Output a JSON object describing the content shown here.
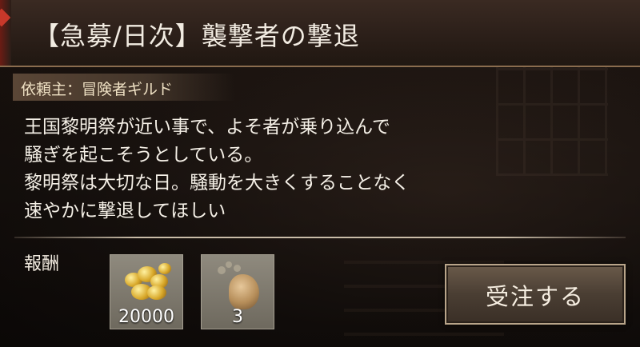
{
  "quest": {
    "title": "【急募/日次】襲撃者の撃退",
    "client": "依頼主：冒険者ギルド",
    "description": [
      "王国黎明祭が近い事で、よそ者が乗り込んで",
      "騒ぎを起こそうとしている。",
      "黎明祭は大切な日。騒動を大きくすることなく",
      "速やかに撃退してほしい"
    ]
  },
  "rewards": {
    "label": "報酬",
    "items": [
      {
        "icon": "gold-coins-icon",
        "count": "20000"
      },
      {
        "icon": "ore-stone-icon",
        "count": "3"
      }
    ]
  },
  "accept_button": {
    "label": "受注する"
  },
  "colors": {
    "accent_red": "#c8382a",
    "gold": "#d8a82a",
    "text": "#f4efe6"
  }
}
